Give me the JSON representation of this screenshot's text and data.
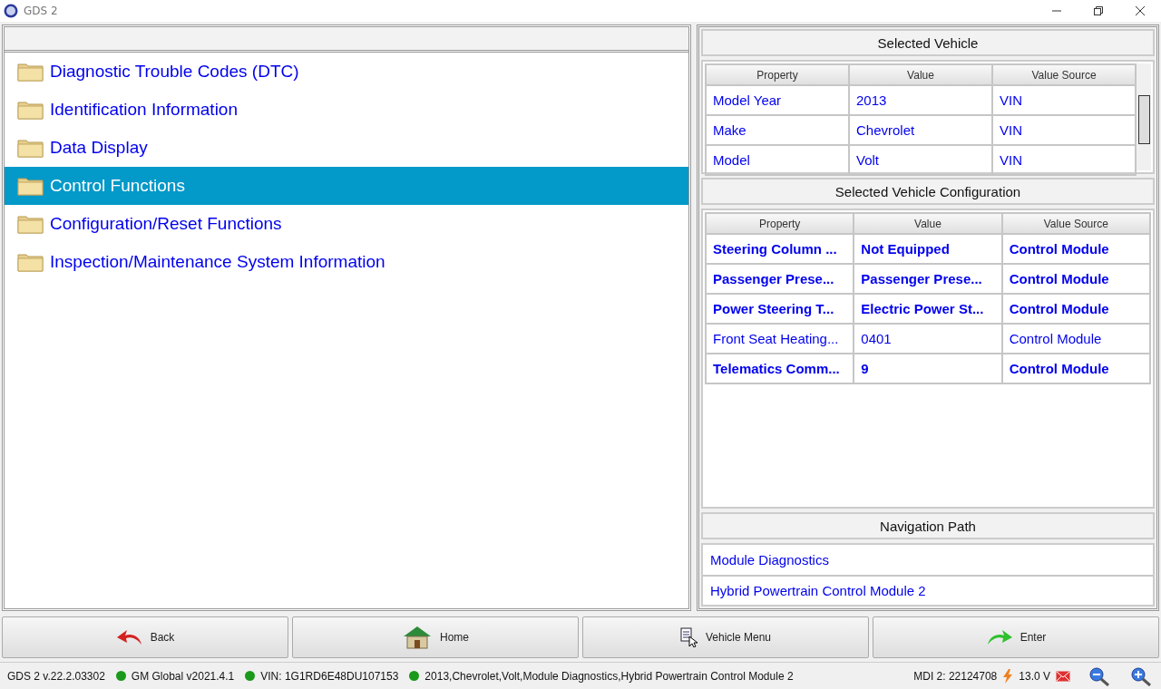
{
  "window": {
    "title": "GDS 2"
  },
  "menu": {
    "items": [
      {
        "label": "Diagnostic Trouble Codes (DTC)",
        "selected": false
      },
      {
        "label": "Identification Information",
        "selected": false
      },
      {
        "label": "Data Display",
        "selected": false
      },
      {
        "label": "Control Functions",
        "selected": true
      },
      {
        "label": "Configuration/Reset Functions",
        "selected": false
      },
      {
        "label": "Inspection/Maintenance System Information",
        "selected": false
      }
    ]
  },
  "selected_vehicle": {
    "title": "Selected Vehicle",
    "columns": [
      "Property",
      "Value",
      "Value Source"
    ],
    "rows": [
      [
        "Model Year",
        "2013",
        "VIN"
      ],
      [
        "Make",
        "Chevrolet",
        "VIN"
      ],
      [
        "Model",
        "Volt",
        "VIN"
      ]
    ]
  },
  "configuration": {
    "title": "Selected Vehicle Configuration",
    "columns": [
      "Property",
      "Value",
      "Value Source"
    ],
    "rows": [
      {
        "cells": [
          "Steering Column ...",
          "Not Equipped",
          "Control Module"
        ],
        "emphasized": true
      },
      {
        "cells": [
          "Passenger Prese...",
          "Passenger Prese...",
          "Control Module"
        ],
        "emphasized": true
      },
      {
        "cells": [
          "Power Steering T...",
          "Electric Power St...",
          "Control Module"
        ],
        "emphasized": true
      },
      {
        "cells": [
          "Front Seat Heating...",
          "0401",
          "Control Module"
        ],
        "emphasized": false
      },
      {
        "cells": [
          "Telematics Comm...",
          "9",
          "Control Module"
        ],
        "emphasized": true
      }
    ]
  },
  "navigation_path": {
    "title": "Navigation Path",
    "items": [
      "Module Diagnostics",
      "Hybrid Powertrain Control Module 2"
    ]
  },
  "buttons": [
    {
      "label": "Back",
      "kind": "back"
    },
    {
      "label": "Home",
      "kind": "home"
    },
    {
      "label": "Vehicle Menu",
      "kind": "menu"
    },
    {
      "label": "Enter",
      "kind": "enter"
    }
  ],
  "status_bar": {
    "version": "GDS 2 v.22.2.03302",
    "items": [
      "GM Global v2021.4.1",
      "VIN: 1G1RD6E48DU107153",
      "2013,Chevrolet,Volt,Module Diagnostics,Hybrid Powertrain Control Module 2"
    ],
    "mdi": "MDI 2: 22124708",
    "voltage": "13.0 V"
  }
}
